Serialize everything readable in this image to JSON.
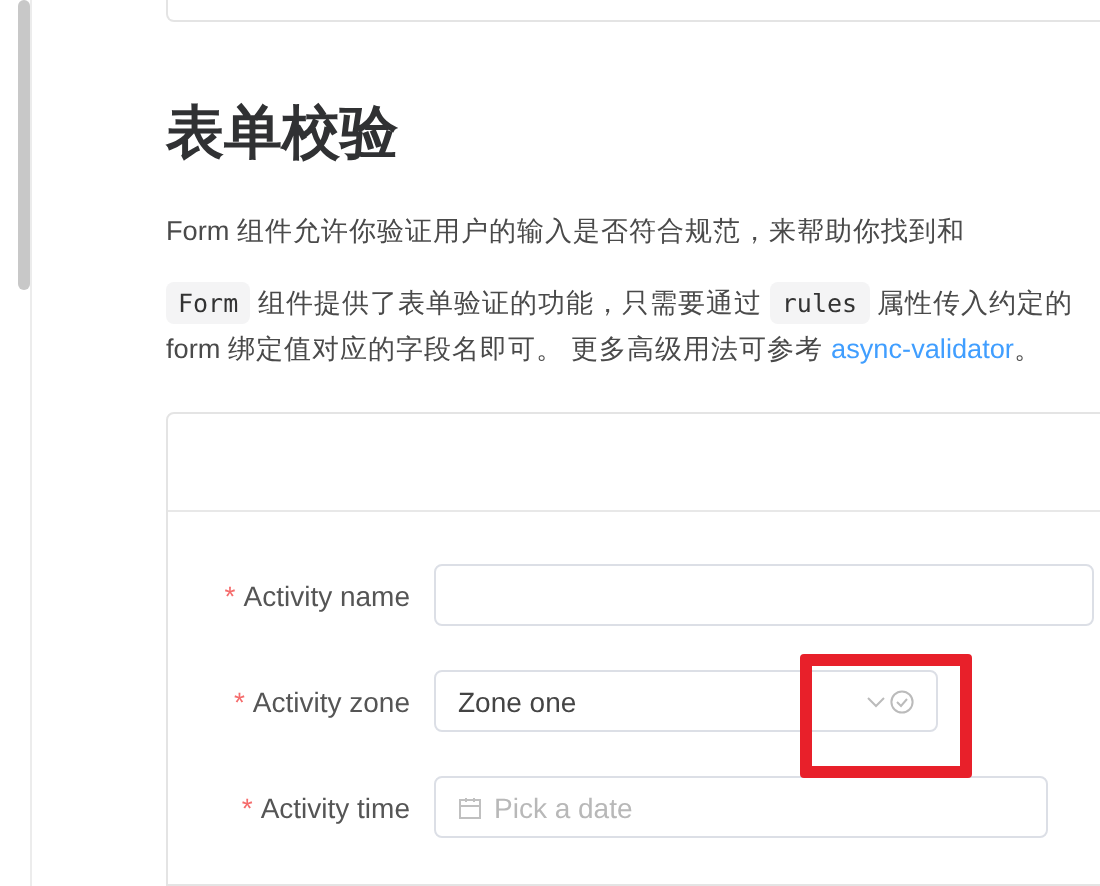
{
  "heading": "表单校验",
  "intro": "Form 组件允许你验证用户的输入是否符合规范，来帮助你找到和",
  "description": {
    "code_1": "Form",
    "text_1": "组件提供了表单验证的功能，只需要通过",
    "code_2": "rules",
    "text_2": "属性传入约定的",
    "line_2": "form 绑定值对应的字段名即可。 更多高级用法可参考",
    "link": "async-validator",
    "end": "。"
  },
  "form": {
    "fields": [
      {
        "kind": "input",
        "label": "Activity name",
        "required_mark": "*"
      },
      {
        "kind": "select",
        "label": "Activity zone",
        "required_mark": "*",
        "value": "Zone one",
        "validated": true
      },
      {
        "kind": "date",
        "label": "Activity time",
        "required_mark": "*",
        "placeholder": "Pick a date"
      }
    ]
  },
  "annotation": {
    "kind": "highlight"
  }
}
